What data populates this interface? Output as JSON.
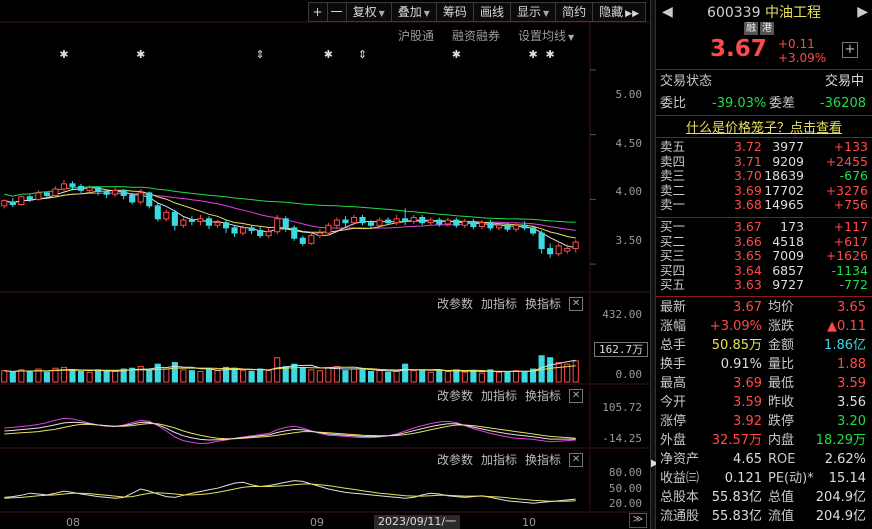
{
  "toolbar": {
    "plus": "+",
    "minus": "一",
    "fuquan": "复权",
    "diejia": "叠加",
    "chouma": "筹码",
    "huaxian": "画线",
    "xianshi": "显示",
    "jianyue": "简约",
    "yincang": "隐藏",
    "nav": "▶▶"
  },
  "sub_toolbar": {
    "hgt": "沪股通",
    "rzrq": "融资融券",
    "ma_setting": "设置均线"
  },
  "indicator_panel": {
    "change_param": "改参数",
    "add_indicator": "加指标",
    "change_indicator": "换指标",
    "close": "✕"
  },
  "price_axis": [
    "5.00",
    "4.50",
    "4.00",
    "3.50"
  ],
  "volume_axis": {
    "top": "432.00",
    "bottom": "0.00",
    "cursor_value": "162.7万"
  },
  "macd_axis": [
    "105.72",
    "-14.25"
  ],
  "kdj_axis": [
    "80.00",
    "50.00",
    "20.00"
  ],
  "x_axis": {
    "labels": [
      "08",
      "09",
      "10"
    ],
    "cursor_date": "2023/09/11/一",
    "scroll": "≫"
  },
  "event_markers": [
    "✱",
    "✱",
    "⇕",
    "✱",
    "⇕",
    "✱",
    "✱",
    "✱"
  ],
  "colors": {
    "up": "#ff4a4a",
    "down": "#3ed8e0",
    "ma5": "#e0e0e0",
    "ma10": "#e8e05a",
    "ma20": "#e040e0",
    "ma60": "#22dd44"
  },
  "chart_data": {
    "type": "candlestick",
    "ylim": [
      3.3,
      5.2
    ],
    "candles": [
      [
        3.95,
        3.99,
        3.93,
        4.0
      ],
      [
        3.98,
        3.96,
        3.94,
        4.01
      ],
      [
        3.96,
        4.02,
        3.95,
        4.03
      ],
      [
        4.02,
        4.0,
        3.98,
        4.04
      ],
      [
        4.0,
        4.05,
        3.99,
        4.07
      ],
      [
        4.05,
        4.03,
        4.01,
        4.06
      ],
      [
        4.03,
        4.08,
        4.02,
        4.1
      ],
      [
        4.08,
        4.12,
        4.06,
        4.15
      ],
      [
        4.12,
        4.1,
        4.08,
        4.14
      ],
      [
        4.1,
        4.07,
        4.05,
        4.12
      ],
      [
        4.07,
        4.09,
        4.05,
        4.11
      ],
      [
        4.09,
        4.06,
        4.03,
        4.1
      ],
      [
        4.06,
        4.04,
        4.01,
        4.08
      ],
      [
        4.04,
        4.07,
        4.02,
        4.09
      ],
      [
        4.07,
        4.03,
        4.0,
        4.08
      ],
      [
        4.03,
        3.98,
        3.96,
        4.05
      ],
      [
        3.98,
        4.05,
        3.96,
        4.08
      ],
      [
        4.05,
        3.95,
        3.93,
        4.06
      ],
      [
        3.95,
        3.85,
        3.83,
        3.97
      ],
      [
        3.85,
        3.9,
        3.83,
        3.92
      ],
      [
        3.9,
        3.8,
        3.76,
        3.92
      ],
      [
        3.8,
        3.84,
        3.78,
        3.86
      ],
      [
        3.84,
        3.83,
        3.8,
        3.87
      ],
      [
        3.83,
        3.85,
        3.8,
        3.88
      ],
      [
        3.85,
        3.8,
        3.77,
        3.87
      ],
      [
        3.8,
        3.82,
        3.78,
        3.84
      ],
      [
        3.82,
        3.78,
        3.74,
        3.84
      ],
      [
        3.78,
        3.74,
        3.71,
        3.8
      ],
      [
        3.74,
        3.78,
        3.72,
        3.8
      ],
      [
        3.78,
        3.76,
        3.73,
        3.8
      ],
      [
        3.76,
        3.72,
        3.7,
        3.79
      ],
      [
        3.72,
        3.75,
        3.7,
        3.78
      ],
      [
        3.75,
        3.85,
        3.73,
        3.88
      ],
      [
        3.85,
        3.78,
        3.75,
        3.87
      ],
      [
        3.78,
        3.7,
        3.68,
        3.8
      ],
      [
        3.7,
        3.66,
        3.64,
        3.72
      ],
      [
        3.66,
        3.72,
        3.65,
        3.75
      ],
      [
        3.72,
        3.74,
        3.7,
        3.77
      ],
      [
        3.74,
        3.8,
        3.72,
        3.82
      ],
      [
        3.8,
        3.84,
        3.78,
        3.86
      ],
      [
        3.84,
        3.82,
        3.79,
        3.87
      ],
      [
        3.82,
        3.86,
        3.8,
        3.88
      ],
      [
        3.86,
        3.82,
        3.8,
        3.88
      ],
      [
        3.82,
        3.8,
        3.78,
        3.84
      ],
      [
        3.8,
        3.84,
        3.78,
        3.86
      ],
      [
        3.84,
        3.82,
        3.8,
        3.86
      ],
      [
        3.82,
        3.85,
        3.8,
        3.88
      ],
      [
        3.85,
        3.83,
        3.8,
        3.93
      ],
      [
        3.83,
        3.86,
        3.81,
        3.88
      ],
      [
        3.86,
        3.82,
        3.8,
        3.88
      ],
      [
        3.82,
        3.84,
        3.8,
        3.86
      ],
      [
        3.84,
        3.81,
        3.79,
        3.86
      ],
      [
        3.81,
        3.84,
        3.79,
        3.86
      ],
      [
        3.84,
        3.8,
        3.78,
        3.86
      ],
      [
        3.8,
        3.83,
        3.78,
        3.85
      ],
      [
        3.83,
        3.79,
        3.77,
        3.85
      ],
      [
        3.79,
        3.82,
        3.77,
        3.84
      ],
      [
        3.82,
        3.78,
        3.76,
        3.84
      ],
      [
        3.78,
        3.8,
        3.76,
        3.82
      ],
      [
        3.8,
        3.77,
        3.75,
        3.82
      ],
      [
        3.77,
        3.8,
        3.75,
        3.82
      ],
      [
        3.8,
        3.78,
        3.76,
        3.83
      ],
      [
        3.78,
        3.74,
        3.72,
        3.8
      ],
      [
        3.74,
        3.62,
        3.58,
        3.76
      ],
      [
        3.62,
        3.58,
        3.55,
        3.66
      ],
      [
        3.58,
        3.64,
        3.56,
        3.66
      ],
      [
        3.6,
        3.62,
        3.58,
        3.65
      ],
      [
        3.62,
        3.67,
        3.59,
        3.69
      ]
    ],
    "volume": [
      70,
      60,
      75,
      65,
      80,
      60,
      85,
      90,
      70,
      65,
      60,
      75,
      70,
      65,
      80,
      85,
      95,
      75,
      110,
      80,
      120,
      75,
      70,
      65,
      80,
      70,
      90,
      85,
      70,
      65,
      80,
      70,
      150,
      95,
      110,
      85,
      75,
      70,
      90,
      95,
      70,
      80,
      75,
      65,
      70,
      60,
      65,
      110,
      70,
      75,
      60,
      70,
      65,
      75,
      60,
      70,
      55,
      75,
      60,
      65,
      70,
      60,
      80,
      162,
      150,
      120,
      110,
      130
    ],
    "volume_ylim": [
      0,
      432
    ],
    "macd_dif": [
      40,
      42,
      45,
      48,
      52,
      58,
      66,
      72,
      70,
      64,
      56,
      50,
      46,
      45,
      50,
      58,
      66,
      62,
      48,
      30,
      10,
      -2,
      -8,
      -12,
      -10,
      -4,
      0,
      6,
      10,
      14,
      18,
      22,
      34,
      42,
      46,
      40,
      30,
      22,
      16,
      14,
      12,
      10,
      8,
      8,
      10,
      14,
      20,
      30,
      40,
      48,
      55,
      60,
      62,
      58,
      48,
      38,
      30,
      22,
      16,
      10,
      6,
      4,
      2,
      -2,
      -6,
      -4,
      -2,
      0
    ],
    "macd_dea": [
      20,
      22,
      24,
      26,
      28,
      32,
      36,
      42,
      48,
      52,
      52,
      50,
      48,
      46,
      46,
      48,
      52,
      55,
      54,
      48,
      40,
      30,
      22,
      16,
      10,
      6,
      4,
      4,
      6,
      8,
      10,
      12,
      16,
      20,
      24,
      28,
      28,
      26,
      24,
      22,
      20,
      18,
      16,
      15,
      14,
      14,
      15,
      18,
      22,
      28,
      34,
      40,
      46,
      50,
      50,
      48,
      44,
      40,
      36,
      32,
      28,
      24,
      20,
      16,
      12,
      10,
      8,
      6
    ],
    "macd_ylim": [
      -20,
      120
    ],
    "kdj_k": [
      30,
      32,
      35,
      40,
      38,
      36,
      40,
      45,
      42,
      38,
      35,
      32,
      30,
      28,
      30,
      40,
      50,
      45,
      38,
      32,
      30,
      35,
      40,
      44,
      48,
      52,
      58,
      64,
      66,
      60,
      56,
      58,
      62,
      66,
      70,
      68,
      62,
      56,
      50,
      46,
      42,
      40,
      38,
      36,
      34,
      32,
      30,
      28,
      30,
      36,
      40,
      38,
      34,
      32,
      30,
      32,
      34,
      30,
      26,
      22,
      20,
      18,
      16,
      18,
      20,
      22,
      24,
      26
    ],
    "kdj_d": [
      28,
      29,
      30,
      32,
      34,
      35,
      36,
      38,
      40,
      40,
      39,
      37,
      35,
      33,
      31,
      32,
      36,
      40,
      41,
      40,
      38,
      36,
      36,
      37,
      39,
      42,
      46,
      50,
      54,
      56,
      56,
      56,
      57,
      58,
      60,
      62,
      62,
      60,
      58,
      55,
      52,
      49,
      46,
      43,
      40,
      38,
      36,
      34,
      33,
      33,
      34,
      35,
      35,
      34,
      33,
      33,
      33,
      32,
      31,
      29,
      27,
      25,
      23,
      22,
      21,
      21,
      21,
      22
    ],
    "kdj_ylim": [
      0,
      100
    ]
  },
  "quote": {
    "code": "600339",
    "name": "中油工程",
    "badge1": "融",
    "badge2": "港",
    "price": "3.67",
    "change": "+0.11",
    "change_pct": "+3.09%",
    "add": "+",
    "status_label": "交易状态",
    "status_value": "交易中",
    "wb_label": "委比",
    "wb_value": "-39.03%",
    "wc_label": "委差",
    "wc_value": "-36208",
    "banner": "什么是价格笼子？点击查看",
    "asks": [
      {
        "name": "卖五",
        "price": "3.72",
        "vol": "3977",
        "chg": "+133",
        "chg_up": true
      },
      {
        "name": "卖四",
        "price": "3.71",
        "vol": "9209",
        "chg": "+2455",
        "chg_up": true
      },
      {
        "name": "卖三",
        "price": "3.70",
        "vol": "18639",
        "chg": "-676",
        "chg_up": false
      },
      {
        "name": "卖二",
        "price": "3.69",
        "vol": "17702",
        "chg": "+3276",
        "chg_up": true
      },
      {
        "name": "卖一",
        "price": "3.68",
        "vol": "14965",
        "chg": "+756",
        "chg_up": true
      }
    ],
    "bids": [
      {
        "name": "买一",
        "price": "3.67",
        "vol": "173",
        "chg": "+117",
        "chg_up": true
      },
      {
        "name": "买二",
        "price": "3.66",
        "vol": "4518",
        "chg": "+617",
        "chg_up": true
      },
      {
        "name": "买三",
        "price": "3.65",
        "vol": "7009",
        "chg": "+1626",
        "chg_up": true
      },
      {
        "name": "买四",
        "price": "3.64",
        "vol": "6857",
        "chg": "-1134",
        "chg_up": false
      },
      {
        "name": "买五",
        "price": "3.63",
        "vol": "9727",
        "chg": "-772",
        "chg_up": false
      }
    ],
    "stats": [
      {
        "l1": "最新",
        "v1": "3.67",
        "c1": "red",
        "l2": "均价",
        "v2": "3.65",
        "c2": "red"
      },
      {
        "l1": "涨幅",
        "v1": "+3.09%",
        "c1": "red",
        "l2": "涨跌",
        "v2": "▲0.11",
        "c2": "red"
      },
      {
        "l1": "总手",
        "v1": "50.85万",
        "c1": "yel",
        "l2": "金额",
        "v2": "1.86亿",
        "c2": "cyn"
      },
      {
        "l1": "换手",
        "v1": "0.91%",
        "c1": "wht",
        "l2": "量比",
        "v2": "1.88",
        "c2": "red"
      },
      {
        "l1": "最高",
        "v1": "3.69",
        "c1": "red",
        "l2": "最低",
        "v2": "3.59",
        "c2": "red"
      },
      {
        "l1": "今开",
        "v1": "3.59",
        "c1": "red",
        "l2": "昨收",
        "v2": "3.56",
        "c2": "wht"
      },
      {
        "l1": "涨停",
        "v1": "3.92",
        "c1": "red",
        "l2": "跌停",
        "v2": "3.20",
        "c2": "grn"
      },
      {
        "l1": "外盘",
        "v1": "32.57万",
        "c1": "red",
        "l2": "内盘",
        "v2": "18.29万",
        "c2": "grn"
      },
      {
        "l1": "净资产",
        "v1": "4.65",
        "c1": "wht",
        "l2": "ROE",
        "v2": "2.62%",
        "c2": "wht"
      },
      {
        "l1": "收益㈢",
        "v1": "0.121",
        "c1": "wht",
        "l2": "PE(动)*",
        "v2": "15.14",
        "c2": "wht"
      },
      {
        "l1": "总股本",
        "v1": "55.83亿",
        "c1": "wht",
        "l2": "总值",
        "v2": "204.9亿",
        "c2": "wht"
      },
      {
        "l1": "流通股",
        "v1": "55.83亿",
        "c1": "wht",
        "l2": "流值",
        "v2": "204.9亿",
        "c2": "wht"
      }
    ]
  }
}
